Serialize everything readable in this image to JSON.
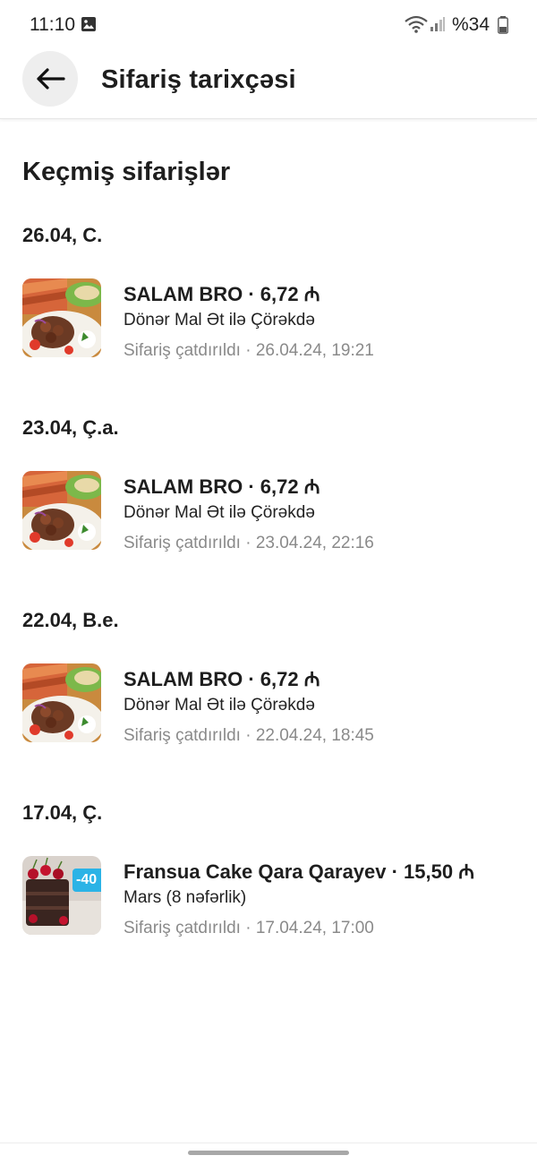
{
  "status_bar": {
    "time": "11:10",
    "battery": "%34",
    "icons": [
      "gallery-icon",
      "wifi-icon",
      "signal-icon",
      "battery-icon"
    ]
  },
  "header": {
    "back_icon": "arrow-left-icon",
    "title": "Sifariş tarixçəsi"
  },
  "section_title": "Keçmiş sifarişlər",
  "groups": [
    {
      "date": "26.04, C.",
      "order": {
        "restaurant": "SALAM BRO",
        "price": "6,72",
        "title": "SALAM BRO · 6,72 ₼",
        "item": "Dönər Mal Ət ilə Çörəkdə",
        "status": "Sifariş çatdırıldı · 26.04.24, 19:21",
        "image": "doner-plate"
      }
    },
    {
      "date": "23.04, Ç.a.",
      "order": {
        "restaurant": "SALAM BRO",
        "price": "6,72",
        "title": "SALAM BRO · 6,72 ₼",
        "item": "Dönər Mal Ət ilə Çörəkdə",
        "status": "Sifariş çatdırıldı · 23.04.24, 22:16",
        "image": "doner-plate"
      }
    },
    {
      "date": "22.04, B.e.",
      "order": {
        "restaurant": "SALAM BRO",
        "price": "6,72",
        "title": "SALAM BRO · 6,72 ₼",
        "item": "Dönər Mal Ət ilə Çörəkdə",
        "status": "Sifariş çatdırıldı · 22.04.24, 18:45",
        "image": "doner-plate"
      }
    },
    {
      "date": "17.04, Ç.",
      "order": {
        "restaurant": "Fransua Cake Qara Qarayev",
        "price": "15,50",
        "title": "Fransua Cake Qara Qarayev · 15,50 ₼",
        "item": "Mars (8 nəfərlik)",
        "status": "Sifariş çatdırıldı · 17.04.24, 17:00",
        "image": "chocolate-cake",
        "badge": "-40"
      }
    }
  ],
  "colors": {
    "text": "#1e1e1e",
    "muted": "#8a8a8a",
    "badge": "#2bb3e6"
  }
}
